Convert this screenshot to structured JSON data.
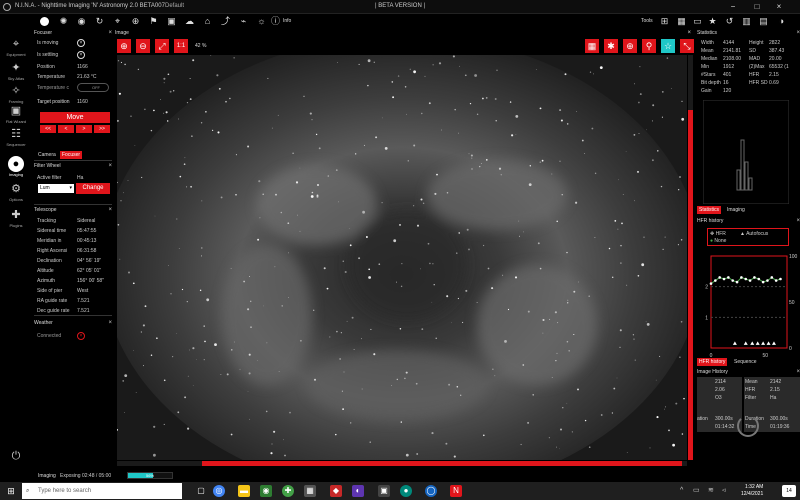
{
  "titlebar": {
    "app_name": "N.I.N.A. - Nighttime Imaging 'N' Astronomy 2.0 BETA007",
    "profile": "Default",
    "beta": "| BETA VERSION |",
    "tools_label": "Tools",
    "info_label": "Info"
  },
  "nav": [
    {
      "label": "Equipment",
      "icon": "telescope-icon"
    },
    {
      "label": "Sky Atlas",
      "icon": "atlas-icon"
    },
    {
      "label": "Framing",
      "icon": "framing-icon"
    },
    {
      "label": "Flat Wizard",
      "icon": "flat-wizard-icon"
    },
    {
      "label": "Sequencer",
      "icon": "sequencer-icon"
    },
    {
      "label": "Imaging",
      "icon": "imaging-icon"
    },
    {
      "label": "Options",
      "icon": "gear-icon"
    },
    {
      "label": "Plugins",
      "icon": "puzzle-icon"
    }
  ],
  "focuser": {
    "title": "Focuser",
    "is_moving_label": "Is moving",
    "is_settling_label": "Is settling",
    "position_label": "Position",
    "position": "1166",
    "temperature_label": "Temperature",
    "temperature": "21.63 °C",
    "temp_comp_label": "Temperature c",
    "temp_comp_state": "OFF",
    "target_label": "Target position",
    "target": "1160",
    "move_label": "Move",
    "steps": [
      "<<",
      "<",
      ">",
      ">>"
    ]
  },
  "camera_tabs": {
    "camera": "Camera",
    "focuser": "Focuser"
  },
  "filter": {
    "title": "Filter Wheel",
    "active_label": "Active filter",
    "active": "Ha",
    "selected": "Lum",
    "change_label": "Change"
  },
  "telescope": {
    "title": "Telescope",
    "rows": [
      {
        "label": "Tracking",
        "value": "Sidereal"
      },
      {
        "label": "Sidereal time",
        "value": "05:47:55"
      },
      {
        "label": "Meridian in",
        "value": "00:45:13"
      },
      {
        "label": "Right Ascensi",
        "value": "06:31:58"
      },
      {
        "label": "Declination",
        "value": "04° 56' 19\""
      },
      {
        "label": "Altitude",
        "value": "62° 05' 01\""
      },
      {
        "label": "Azimuth",
        "value": "156° 00' 58\""
      },
      {
        "label": "Side of pier",
        "value": "West"
      },
      {
        "label": "RA guide rate",
        "value": "7.521"
      },
      {
        "label": "Dec guide rate",
        "value": "7.521"
      }
    ]
  },
  "weather": {
    "title": "Weather",
    "connected_label": "Connected"
  },
  "image": {
    "title": "Image",
    "zoom_in": "⊕",
    "zoom_out": "⊖",
    "fit": "1:1",
    "zoom": "42 %"
  },
  "statistics": {
    "title": "Statistics",
    "rows": [
      [
        "Width",
        "4144",
        "Height",
        "2822"
      ],
      [
        "Mean",
        "2141.81",
        "SD",
        "387.43"
      ],
      [
        "Median",
        "2108.00",
        "MAD",
        "20.00"
      ],
      [
        "Min",
        "1912",
        "(2)Max",
        "65532 (1"
      ],
      [
        "#Stars",
        "401",
        "HFR",
        "2.15"
      ],
      [
        "Bit depth",
        "16",
        "HFR SD",
        "0.69"
      ],
      [
        "Gain",
        "120",
        "",
        ""
      ]
    ]
  },
  "stat_tabs": {
    "statistics": "Statistics",
    "imaging": "Imaging"
  },
  "hfr_history": {
    "title": "HFR history",
    "legend_hfr": "HFR",
    "legend_autofocus": "Autofocus",
    "legend_none": "None",
    "y_ticks": [
      "100",
      "50",
      "0"
    ],
    "y_left": [
      "2",
      "1"
    ],
    "x_ticks": [
      "0",
      "50"
    ]
  },
  "hfr_tabs": {
    "hfr": "HFR history",
    "sequence": "Sequence"
  },
  "image_history": {
    "title": "Image History",
    "cards": [
      {
        "mean_label": "",
        "mean": "2114",
        "hfr": "2.06",
        "filter": "O3",
        "duration_label": "ation",
        "duration": "300.00s",
        "time_label": "",
        "time": "01:14:32"
      },
      {
        "mean_label": "Mean",
        "mean": "2142",
        "hfr_label": "HFR",
        "hfr": "2.15",
        "filter_label": "Filter",
        "filter": "Ha",
        "duration_label": "Duration",
        "duration": "300.00s",
        "time_label": "Time",
        "time": "01:19:36"
      }
    ]
  },
  "status": {
    "label": "Imaging",
    "text": "Exposing 02:48 / 05:00",
    "progress_text": "56%",
    "progress": 0.56
  },
  "taskbar": {
    "search_placeholder": "Type here to search",
    "time": "1:32 AM",
    "date": "12/4/2021",
    "badge": "14"
  },
  "chart_data": {
    "type": "scatter",
    "title": "HFR history",
    "series": [
      {
        "name": "HFR",
        "x": [
          0,
          4,
          8,
          12,
          16,
          20,
          24,
          28,
          32,
          36,
          40,
          44,
          48,
          52,
          56,
          60,
          64
        ],
        "y": [
          2.1,
          2.2,
          2.3,
          2.25,
          2.3,
          2.2,
          2.15,
          2.3,
          2.25,
          2.2,
          2.3,
          2.25,
          2.15,
          2.2,
          2.3,
          2.2,
          2.25
        ]
      },
      {
        "name": "Autofocus",
        "x": [
          22,
          32,
          38,
          43,
          48,
          53,
          58
        ],
        "y": [
          5,
          5,
          5,
          5,
          5,
          5,
          5
        ]
      }
    ],
    "ylim": [
      0,
      3
    ],
    "xlim": [
      0,
      70
    ],
    "y2lim": [
      0,
      100
    ]
  }
}
